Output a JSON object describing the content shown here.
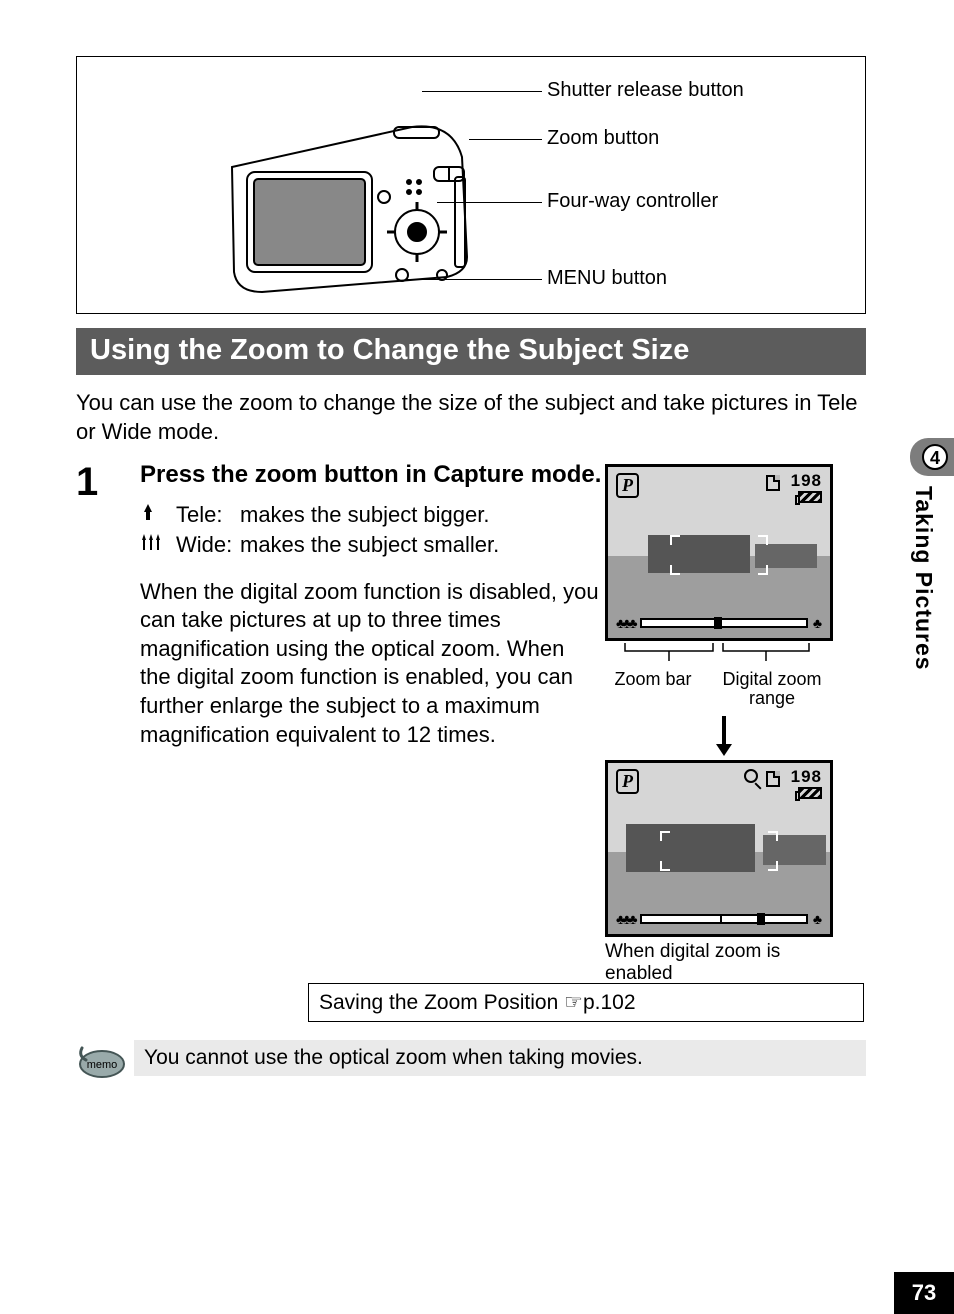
{
  "diagram": {
    "labels": {
      "shutter": "Shutter release button",
      "zoom": "Zoom button",
      "fourway": "Four-way controller",
      "menu": "MENU button"
    }
  },
  "section_title": "Using the Zoom to Change the Subject Size",
  "intro": "You can use the zoom to change the size of the subject and take pictures in Tele or Wide mode.",
  "step": {
    "number": "1",
    "heading": "Press the zoom button in Capture mode.",
    "tele_label": "Tele:",
    "tele_desc": "makes the subject bigger.",
    "wide_label": "Wide:",
    "wide_desc": "makes the subject smaller.",
    "paragraph": "When the digital zoom function is disabled, you can take pictures at up to three times magnification using the optical zoom. When the digital zoom function is enabled, you can further enlarge the subject to a maximum magnification equivalent to 12 times."
  },
  "screens": {
    "mode_letter": "P",
    "shots_remaining": "198",
    "caption_zoom_bar": "Zoom bar",
    "caption_digital_range_l1": "Digital zoom",
    "caption_digital_range_l2": "range",
    "caption_enabled": "When digital zoom is enabled"
  },
  "ref_box": "Saving the Zoom Position ☞p.102",
  "memo": {
    "badge": "memo",
    "text": "You cannot use the optical zoom when taking movies."
  },
  "side_tab": {
    "chapter_number": "4",
    "chapter_title": "Taking Pictures"
  },
  "page_number": "73"
}
